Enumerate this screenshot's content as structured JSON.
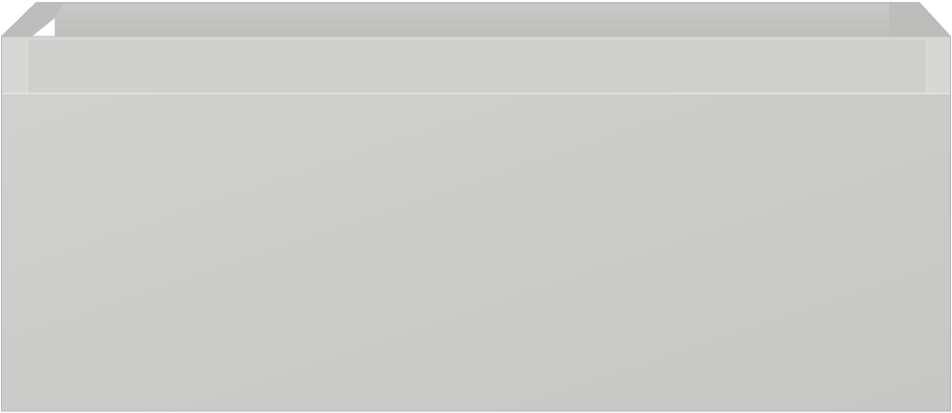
{
  "image": {
    "subject": "drawer-unit",
    "colors": {
      "front_panel": "#cbcbc9",
      "front_panel_light": "#d0d0ce",
      "front_panel_shade": "#c6c6c4",
      "inner_back_wall": "#c9c9c7",
      "inner_side_wall": "#bdbdbb",
      "top_rim": "#d6d6d4",
      "rim_lip": "#cfcfcd",
      "edge_highlight": "#e6e6e4",
      "edge_shadow": "#b3b3b1",
      "background": "#ffffff"
    }
  }
}
